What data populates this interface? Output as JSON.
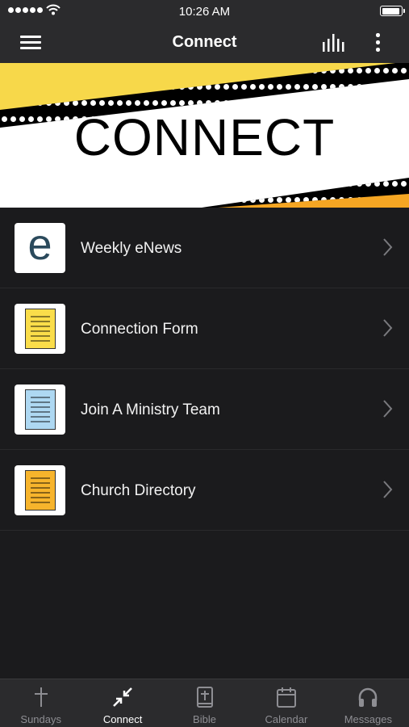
{
  "status_bar": {
    "time": "10:26 AM"
  },
  "nav": {
    "title": "Connect"
  },
  "banner": {
    "title": "CONNECT",
    "colors": {
      "stripe": "#f7d84a",
      "bottom_corner": "#f5a623",
      "film": "#000000"
    }
  },
  "list": {
    "items": [
      {
        "label": "Weekly eNews",
        "icon": "enews-e-icon"
      },
      {
        "label": "Connection Form",
        "icon": "yellow-document-icon",
        "color": "#fadd4a"
      },
      {
        "label": "Join A Ministry Team",
        "icon": "blue-document-icon",
        "color": "#aed8f2"
      },
      {
        "label": "Church Directory",
        "icon": "orange-document-icon",
        "color": "#f7b42c"
      }
    ]
  },
  "tabs": [
    {
      "label": "Sundays",
      "icon": "cross-icon",
      "active": false
    },
    {
      "label": "Connect",
      "icon": "connect-arrows-icon",
      "active": true
    },
    {
      "label": "Bible",
      "icon": "bible-icon",
      "active": false
    },
    {
      "label": "Calendar",
      "icon": "calendar-icon",
      "active": false
    },
    {
      "label": "Messages",
      "icon": "headphones-icon",
      "active": false
    }
  ]
}
